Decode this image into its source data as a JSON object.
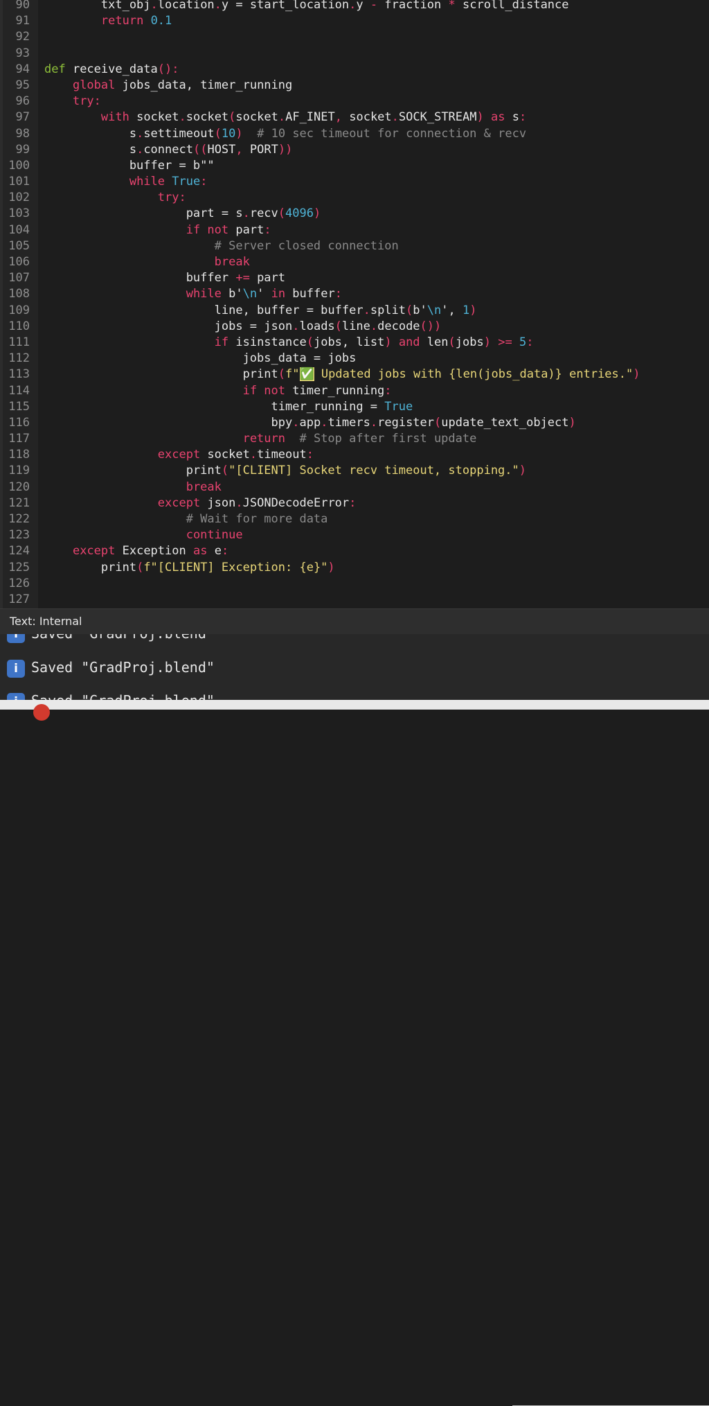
{
  "editor": {
    "lines": [
      {
        "n": "90",
        "t": [
          [
            "        txt_obj",
            "d"
          ],
          [
            ".",
            "p"
          ],
          [
            "location",
            "d"
          ],
          [
            ".",
            "p"
          ],
          [
            "y = start_location",
            "d"
          ],
          [
            ".",
            "p"
          ],
          [
            "y ",
            "d"
          ],
          [
            "-",
            "p"
          ],
          [
            " fraction ",
            "d"
          ],
          [
            "*",
            "p"
          ],
          [
            " scroll_distance",
            "d"
          ]
        ]
      },
      {
        "n": "91",
        "t": [
          [
            "        ",
            "d"
          ],
          [
            "return",
            "k"
          ],
          [
            " ",
            "d"
          ],
          [
            "0.1",
            "n"
          ]
        ]
      },
      {
        "n": "92",
        "t": []
      },
      {
        "n": "93",
        "t": []
      },
      {
        "n": "94",
        "t": [
          [
            "def",
            "f"
          ],
          [
            " receive_data",
            "d"
          ],
          [
            "():",
            "p"
          ]
        ]
      },
      {
        "n": "95",
        "t": [
          [
            "    ",
            "d"
          ],
          [
            "global",
            "k"
          ],
          [
            " jobs_data, timer_running",
            "d"
          ]
        ]
      },
      {
        "n": "96",
        "t": [
          [
            "    ",
            "d"
          ],
          [
            "try",
            "k"
          ],
          [
            ":",
            "p"
          ]
        ]
      },
      {
        "n": "97",
        "t": [
          [
            "        ",
            "d"
          ],
          [
            "with",
            "k"
          ],
          [
            " socket",
            "d"
          ],
          [
            ".",
            "p"
          ],
          [
            "socket",
            "d"
          ],
          [
            "(",
            "p"
          ],
          [
            "socket",
            "d"
          ],
          [
            ".",
            "p"
          ],
          [
            "AF_INET",
            "d"
          ],
          [
            ",",
            "p"
          ],
          [
            " socket",
            "d"
          ],
          [
            ".",
            "p"
          ],
          [
            "SOCK_STREAM",
            "d"
          ],
          [
            ")",
            "p"
          ],
          [
            " ",
            "d"
          ],
          [
            "as",
            "k"
          ],
          [
            " s",
            "d"
          ],
          [
            ":",
            "p"
          ]
        ]
      },
      {
        "n": "98",
        "t": [
          [
            "            s",
            "d"
          ],
          [
            ".",
            "p"
          ],
          [
            "settimeout",
            "d"
          ],
          [
            "(",
            "p"
          ],
          [
            "10",
            "n"
          ],
          [
            ")",
            "p"
          ],
          [
            "  ",
            "d"
          ],
          [
            "# 10 sec timeout for connection & recv",
            "c"
          ]
        ]
      },
      {
        "n": "99",
        "t": [
          [
            "            s",
            "d"
          ],
          [
            ".",
            "p"
          ],
          [
            "connect",
            "d"
          ],
          [
            "((",
            "p"
          ],
          [
            "HOST",
            "d"
          ],
          [
            ",",
            "p"
          ],
          [
            " PORT",
            "d"
          ],
          [
            "))",
            "p"
          ]
        ]
      },
      {
        "n": "100",
        "t": [
          [
            "            buffer = b\"\"",
            "d"
          ]
        ]
      },
      {
        "n": "101",
        "t": [
          [
            "            ",
            "d"
          ],
          [
            "while",
            "k"
          ],
          [
            " ",
            "d"
          ],
          [
            "True",
            "n"
          ],
          [
            ":",
            "p"
          ]
        ]
      },
      {
        "n": "102",
        "t": [
          [
            "                ",
            "d"
          ],
          [
            "try",
            "k"
          ],
          [
            ":",
            "p"
          ]
        ]
      },
      {
        "n": "103",
        "t": [
          [
            "                    part = s",
            "d"
          ],
          [
            ".",
            "p"
          ],
          [
            "recv",
            "d"
          ],
          [
            "(",
            "p"
          ],
          [
            "4096",
            "n"
          ],
          [
            ")",
            "p"
          ]
        ]
      },
      {
        "n": "104",
        "t": [
          [
            "                    ",
            "d"
          ],
          [
            "if not",
            "k"
          ],
          [
            " part",
            "d"
          ],
          [
            ":",
            "p"
          ]
        ]
      },
      {
        "n": "105",
        "t": [
          [
            "                        ",
            "d"
          ],
          [
            "# Server closed connection",
            "c"
          ]
        ]
      },
      {
        "n": "106",
        "t": [
          [
            "                        ",
            "d"
          ],
          [
            "break",
            "k"
          ]
        ]
      },
      {
        "n": "107",
        "t": [
          [
            "                    buffer ",
            "d"
          ],
          [
            "+=",
            "p"
          ],
          [
            " part",
            "d"
          ]
        ]
      },
      {
        "n": "108",
        "t": [
          [
            "                    ",
            "d"
          ],
          [
            "while",
            "k"
          ],
          [
            " b'",
            "d"
          ],
          [
            "\\n",
            "n"
          ],
          [
            "' ",
            "d"
          ],
          [
            "in",
            "k"
          ],
          [
            " buffer",
            "d"
          ],
          [
            ":",
            "p"
          ]
        ]
      },
      {
        "n": "109",
        "t": [
          [
            "                        line, buffer = buffer",
            "d"
          ],
          [
            ".",
            "p"
          ],
          [
            "split",
            "d"
          ],
          [
            "(",
            "p"
          ],
          [
            "b'",
            "d"
          ],
          [
            "\\n",
            "n"
          ],
          [
            "', ",
            "d"
          ],
          [
            "1",
            "n"
          ],
          [
            ")",
            "p"
          ]
        ]
      },
      {
        "n": "110",
        "t": [
          [
            "                        jobs = json",
            "d"
          ],
          [
            ".",
            "p"
          ],
          [
            "loads",
            "d"
          ],
          [
            "(",
            "p"
          ],
          [
            "line",
            "d"
          ],
          [
            ".",
            "p"
          ],
          [
            "decode",
            "d"
          ],
          [
            "())",
            "p"
          ]
        ]
      },
      {
        "n": "111",
        "t": [
          [
            "                        ",
            "d"
          ],
          [
            "if",
            "k"
          ],
          [
            " isinstance",
            "d"
          ],
          [
            "(",
            "p"
          ],
          [
            "jobs, list",
            "d"
          ],
          [
            ")",
            "p"
          ],
          [
            " ",
            "d"
          ],
          [
            "and",
            "k"
          ],
          [
            " len",
            "d"
          ],
          [
            "(",
            "p"
          ],
          [
            "jobs",
            "d"
          ],
          [
            ")",
            "p"
          ],
          [
            " ",
            "d"
          ],
          [
            ">=",
            "k"
          ],
          [
            " ",
            "d"
          ],
          [
            "5",
            "n"
          ],
          [
            ":",
            "p"
          ]
        ]
      },
      {
        "n": "112",
        "t": [
          [
            "                            jobs_data = jobs",
            "d"
          ]
        ]
      },
      {
        "n": "113",
        "t": [
          [
            "                            print",
            "d"
          ],
          [
            "(",
            "p"
          ],
          [
            "f\"",
            "s"
          ],
          [
            "✅",
            "x"
          ],
          [
            " Updated jobs with {len(jobs_data)} entries.\"",
            "s"
          ],
          [
            ")",
            "p"
          ]
        ]
      },
      {
        "n": "114",
        "t": [
          [
            "                            ",
            "d"
          ],
          [
            "if not",
            "k"
          ],
          [
            " timer_running",
            "d"
          ],
          [
            ":",
            "p"
          ]
        ]
      },
      {
        "n": "115",
        "t": [
          [
            "                                timer_running = ",
            "d"
          ],
          [
            "True",
            "n"
          ]
        ]
      },
      {
        "n": "116",
        "t": [
          [
            "                                bpy",
            "d"
          ],
          [
            ".",
            "p"
          ],
          [
            "app",
            "d"
          ],
          [
            ".",
            "p"
          ],
          [
            "timers",
            "d"
          ],
          [
            ".",
            "p"
          ],
          [
            "register",
            "d"
          ],
          [
            "(",
            "p"
          ],
          [
            "update_text_object",
            "d"
          ],
          [
            ")",
            "p"
          ]
        ]
      },
      {
        "n": "117",
        "t": [
          [
            "                            ",
            "d"
          ],
          [
            "return",
            "k"
          ],
          [
            "  ",
            "d"
          ],
          [
            "# Stop after first update",
            "c"
          ]
        ]
      },
      {
        "n": "118",
        "t": [
          [
            "                ",
            "d"
          ],
          [
            "except",
            "k"
          ],
          [
            " socket",
            "d"
          ],
          [
            ".",
            "p"
          ],
          [
            "timeout",
            "d"
          ],
          [
            ":",
            "p"
          ]
        ]
      },
      {
        "n": "119",
        "t": [
          [
            "                    print",
            "d"
          ],
          [
            "(",
            "p"
          ],
          [
            "\"[CLIENT] Socket recv timeout, stopping.\"",
            "s"
          ],
          [
            ")",
            "p"
          ]
        ]
      },
      {
        "n": "120",
        "t": [
          [
            "                    ",
            "d"
          ],
          [
            "break",
            "k"
          ]
        ]
      },
      {
        "n": "121",
        "t": [
          [
            "                ",
            "d"
          ],
          [
            "except",
            "k"
          ],
          [
            " json",
            "d"
          ],
          [
            ".",
            "p"
          ],
          [
            "JSONDecodeError",
            "d"
          ],
          [
            ":",
            "p"
          ]
        ]
      },
      {
        "n": "122",
        "t": [
          [
            "                    ",
            "d"
          ],
          [
            "# Wait for more data",
            "c"
          ]
        ]
      },
      {
        "n": "123",
        "t": [
          [
            "                    ",
            "d"
          ],
          [
            "continue",
            "k"
          ]
        ]
      },
      {
        "n": "124",
        "t": [
          [
            "    ",
            "d"
          ],
          [
            "except",
            "k"
          ],
          [
            " Exception ",
            "d"
          ],
          [
            "as",
            "k"
          ],
          [
            " e",
            "d"
          ],
          [
            ":",
            "p"
          ]
        ]
      },
      {
        "n": "125",
        "t": [
          [
            "        print",
            "d"
          ],
          [
            "(",
            "p"
          ],
          [
            "f\"[CLIENT] Exception: {e}\"",
            "s"
          ],
          [
            ")",
            "p"
          ]
        ]
      },
      {
        "n": "126",
        "t": []
      },
      {
        "n": "127",
        "t": []
      }
    ]
  },
  "status": {
    "text": "Text: Internal"
  },
  "info": {
    "messages": [
      "Saved \"GradProj.blend\"",
      "Saved \"GradProj.blend\"",
      "Saved \"GradProj.blend\""
    ],
    "icon_glyph": "i"
  },
  "colors": {
    "keyword": "#e8436f",
    "function_def": "#8fc13a",
    "number": "#4fb3d6",
    "string": "#e8d678",
    "comment": "#8a8a8a",
    "info_icon": "#3f74c6"
  }
}
